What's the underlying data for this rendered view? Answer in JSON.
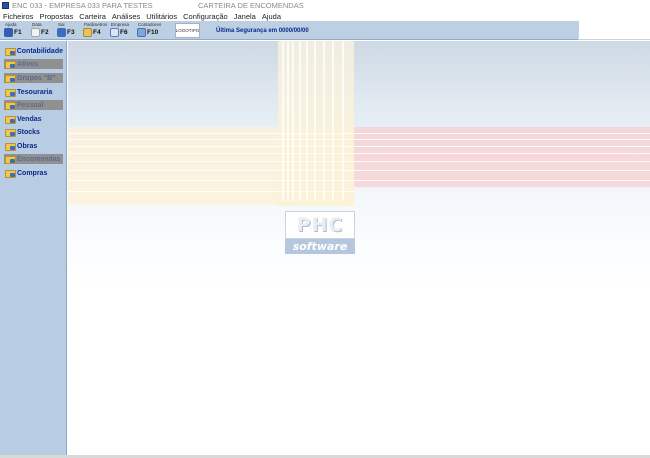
{
  "app": {
    "title": "ENC 033 - EMPRESA 033 PARA TESTES",
    "window_title": "CARTEIRA DE ENCOMENDAS"
  },
  "menu": [
    "Ficheiros",
    "Propostas",
    "Carteira",
    "Análises",
    "Utilitários",
    "Configuração",
    "Janela",
    "Ajuda"
  ],
  "toolbar": {
    "buttons": [
      {
        "caption": "Ajuda",
        "key": "F1",
        "icon": "help-icon"
      },
      {
        "caption": "Data",
        "key": "F2",
        "icon": "calendar-icon"
      },
      {
        "caption": "Sai",
        "key": "F3",
        "icon": "user-icon"
      },
      {
        "caption": "Parâmetros",
        "key": "F4",
        "icon": "folder-icon"
      },
      {
        "caption": "Empresa",
        "key": "F6",
        "icon": "company-icon"
      },
      {
        "caption": "Contadores",
        "key": "F10",
        "icon": "counter-icon"
      }
    ],
    "logo_label": "LOGOTIPO",
    "last_backup_label": "Última Segurança em",
    "last_backup_value": "0000/00/00"
  },
  "sidebar": {
    "items": [
      {
        "label": "Contabilidade",
        "enabled": true
      },
      {
        "label": "Ativos",
        "enabled": false
      },
      {
        "label": "Grupos \"B\"",
        "enabled": false
      },
      {
        "label": "Tesouraria",
        "enabled": true
      },
      {
        "label": "Pessoal",
        "enabled": false
      },
      {
        "label": "Vendas",
        "enabled": true
      },
      {
        "label": "Stocks",
        "enabled": true
      },
      {
        "label": "Obras",
        "enabled": true
      },
      {
        "label": "Encomendas",
        "enabled": false
      },
      {
        "label": "Compras",
        "enabled": true
      }
    ]
  },
  "brand": {
    "name_top": "PHC",
    "name_bottom": "software"
  },
  "colors": {
    "sidebar_bg": "#b8cce4",
    "toolbar_bg": "#bdcfe3",
    "sidebar_label": "#0b2a86",
    "disabled_item": "#909090"
  }
}
